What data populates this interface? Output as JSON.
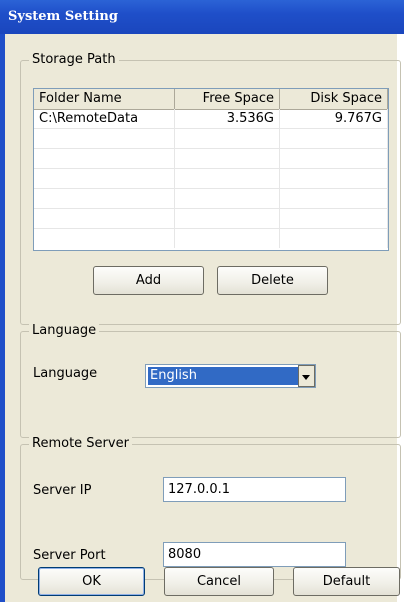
{
  "window": {
    "title": "System Setting"
  },
  "storage": {
    "group_label": "Storage Path",
    "columns": [
      "Folder Name",
      "Free Space",
      "Disk Space"
    ],
    "rows": [
      [
        "C:\\RemoteData",
        "3.536G",
        "9.767G"
      ],
      [
        "",
        "",
        ""
      ],
      [
        "",
        "",
        ""
      ],
      [
        "",
        "",
        ""
      ],
      [
        "",
        "",
        ""
      ],
      [
        "",
        "",
        ""
      ],
      [
        "",
        "",
        ""
      ]
    ],
    "add_label": "Add",
    "delete_label": "Delete"
  },
  "language": {
    "group_label": "Language",
    "field_label": "Language",
    "selected": "English"
  },
  "remote": {
    "group_label": "Remote Server",
    "ip_label": "Server IP",
    "ip_value": "127.0.0.1",
    "port_label": "Server Port",
    "port_value": "8080"
  },
  "footer": {
    "ok_label": "OK",
    "cancel_label": "Cancel",
    "default_label": "Default"
  },
  "colors": {
    "titlebar": "#1f4fc9",
    "dialog_bg": "#ece9d8",
    "selection": "#316ac5"
  }
}
